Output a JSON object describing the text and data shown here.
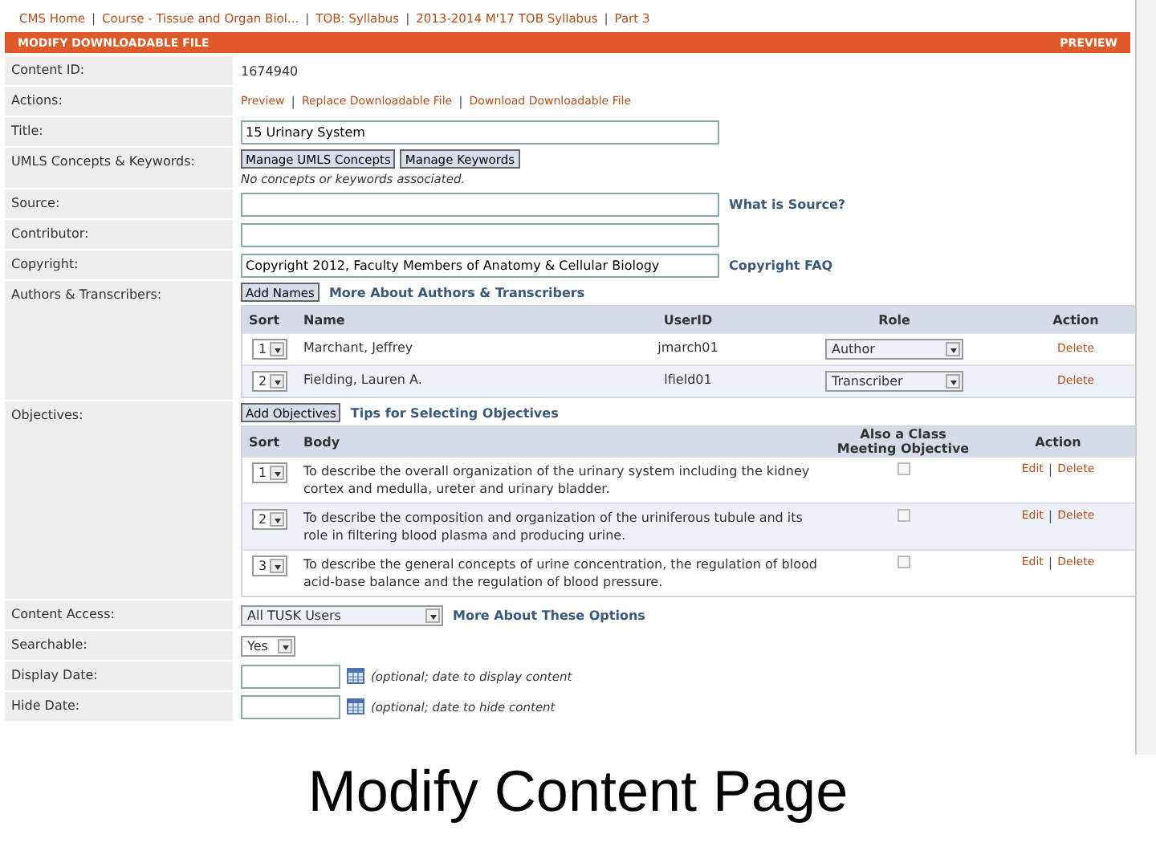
{
  "separator": "|",
  "breadcrumb": [
    "CMS Home",
    "Course - Tissue and Organ Biol...",
    "TOB: Syllabus",
    "2013-2014 M'17 TOB Syllabus",
    "Part 3"
  ],
  "header": {
    "title": "MODIFY DOWNLOADABLE FILE",
    "link": "PREVIEW"
  },
  "fields": [
    {
      "kind": "text",
      "label": "Content ID:",
      "value": "1674940"
    },
    {
      "kind": "links",
      "label": "Actions:",
      "links": [
        "Preview",
        "Replace Downloadable File",
        "Download Downloadable File"
      ]
    },
    {
      "kind": "input",
      "label": "Title:",
      "value": "15 Urinary System"
    },
    {
      "kind": "buttons",
      "label": "UMLS Concepts & Keywords:",
      "buttons": [
        "Manage UMLS Concepts",
        "Manage Keywords"
      ],
      "note": "No concepts or keywords associated."
    },
    {
      "kind": "input",
      "label": "Source:",
      "help": "What is Source?"
    },
    {
      "kind": "input",
      "label": "Contributor:"
    },
    {
      "kind": "input",
      "label": "Copyright:",
      "value": "Copyright 2012, Faculty Members of Anatomy & Cellular Biology",
      "help": "Copyright FAQ"
    },
    {
      "kind": "authors",
      "label": "Authors & Transcribers:",
      "button": "Add Names",
      "help": "More About Authors & Transcribers"
    },
    {
      "kind": "objectives",
      "label": "Objectives:",
      "button": "Add Objectives",
      "help": "Tips for Selecting Objectives"
    },
    {
      "kind": "select",
      "label": "Content Access:",
      "value": "All TUSK Users",
      "help": "More About These Options"
    },
    {
      "kind": "small-select",
      "label": "Searchable:",
      "value": "Yes"
    },
    {
      "kind": "date",
      "label": "Display Date:",
      "note": "(optional; date to display content"
    },
    {
      "kind": "date",
      "label": "Hide Date:",
      "note": "(optional; date to hide content"
    }
  ],
  "authors": {
    "columns": [
      "Sort",
      "Name",
      "UserID",
      "Role",
      "Action"
    ],
    "rows": [
      {
        "sort": "1",
        "name": "Marchant, Jeffrey",
        "userid": "jmarch01",
        "role": "Author",
        "action": "Delete"
      },
      {
        "sort": "2",
        "name": "Fielding, Lauren A.",
        "userid": "lfield01",
        "role": "Transcriber",
        "action": "Delete"
      }
    ]
  },
  "objectives": {
    "columns": [
      "Sort",
      "Body",
      "Also a Class Meeting Objective",
      "Action"
    ],
    "rows": [
      {
        "sort": "1",
        "body": "To describe the overall organization of the urinary system including the kidney cortex and medulla, ureter and urinary bladder.",
        "checked": false,
        "actions": [
          "Edit",
          "Delete"
        ]
      },
      {
        "sort": "2",
        "body": "To describe the composition and organization of the uriniferous tubule and its role in filtering blood plasma and producing urine.",
        "checked": false,
        "actions": [
          "Edit",
          "Delete"
        ]
      },
      {
        "sort": "3",
        "body": "To describe the general concepts of urine concentration, the regulation of blood acid-base balance and the regulation of blood pressure.",
        "checked": false,
        "actions": [
          "Edit",
          "Delete"
        ]
      }
    ]
  },
  "caption": "Modify Content Page"
}
